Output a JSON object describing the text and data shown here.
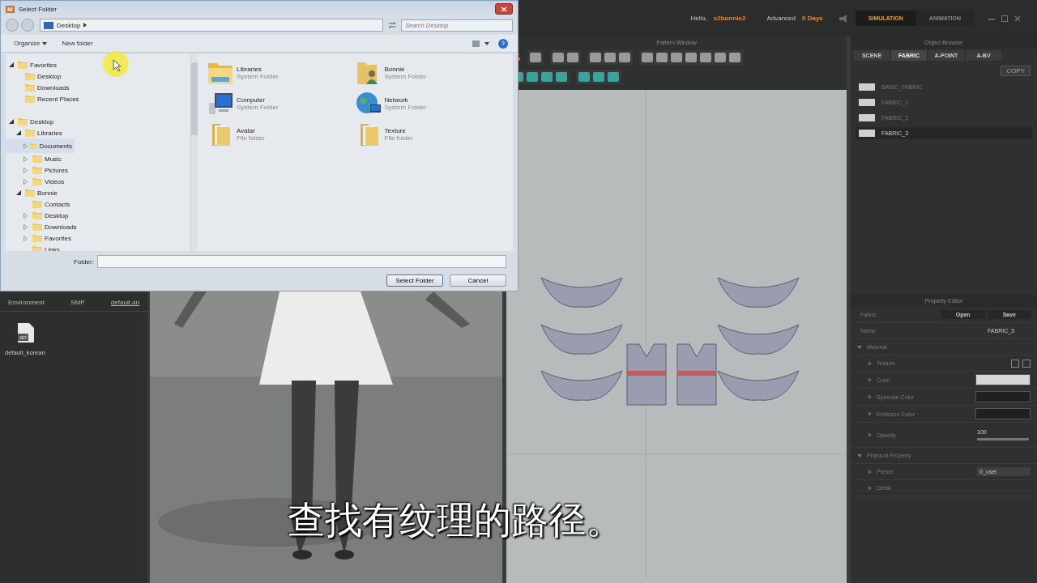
{
  "top_bar": {
    "greeting": "Hello,",
    "user": "s2bonnie2",
    "plan": "Advanced",
    "days": "0 Days",
    "modes": [
      {
        "label": "SIMULATION",
        "selected": true
      },
      {
        "label": "ANIMATION",
        "selected": false
      }
    ]
  },
  "left_panel": {
    "tabs": [
      {
        "label": "Environment",
        "selected": false
      },
      {
        "label": "SMP",
        "selected": false
      },
      {
        "label": "default.an",
        "selected": true
      }
    ],
    "files": [
      {
        "badge": "an",
        "name": "default_korean"
      }
    ]
  },
  "pattern_window": {
    "title": "Pattern Window"
  },
  "object_browser": {
    "title": "Object Browser",
    "tabs": [
      {
        "label": "SCENE",
        "selected": false
      },
      {
        "label": "FABRIC",
        "selected": true
      },
      {
        "label": "A-POINT",
        "selected": false
      },
      {
        "label": "A-BV",
        "selected": false
      }
    ],
    "buttons": [
      "COPY"
    ],
    "fabrics": [
      {
        "name": "BASIC_FABRIC",
        "selected": false
      },
      {
        "name": "FABRIC_1",
        "selected": false
      },
      {
        "name": "FABRIC_2",
        "selected": false
      },
      {
        "name": "FABRIC_3",
        "selected": true
      }
    ]
  },
  "property_editor": {
    "title": "Property Editor",
    "rows": [
      {
        "kind": "buttons",
        "label": "Fabric",
        "buttons": [
          "Open",
          "Save"
        ]
      },
      {
        "kind": "value",
        "label": "Name",
        "value": "FABRIC_3"
      },
      {
        "kind": "section",
        "label": "Material",
        "expanded": true
      },
      {
        "kind": "texture",
        "label": "Texture"
      },
      {
        "kind": "color",
        "label": "Color",
        "color": "#d6d6d6"
      },
      {
        "kind": "color",
        "label": "Specular Color",
        "color": "#1f2020"
      },
      {
        "kind": "color",
        "label": "Emission Color",
        "color": "#1f2020"
      },
      {
        "kind": "slider",
        "label": "Opacity",
        "value": "100",
        "level": 0.97
      },
      {
        "kind": "section",
        "label": "Physical Property",
        "expanded": true
      },
      {
        "kind": "select",
        "label": "Preset",
        "value": "0_user"
      },
      {
        "kind": "item",
        "label": "Detail"
      }
    ]
  },
  "dialog": {
    "title": "Select Folder",
    "app_icon_text": "M",
    "address": "Desktop",
    "search_placeholder": "Search Desktop",
    "toolbar": [
      {
        "label": "Organize",
        "dropdown": true
      },
      {
        "label": "New folder",
        "dropdown": false
      }
    ],
    "tree": [
      {
        "label": "Favorites",
        "kind": "expanded",
        "selected": false,
        "children": [
          {
            "label": "Desktop",
            "kind": "leaf",
            "selected": false
          },
          {
            "label": "Downloads",
            "kind": "leaf",
            "selected": false
          },
          {
            "label": "Recent Places",
            "kind": "leaf",
            "selected": false
          }
        ]
      },
      {
        "label": "Desktop",
        "kind": "expanded",
        "selected": false,
        "children": [
          {
            "label": "Libraries",
            "kind": "expanded",
            "selected": false,
            "children": [
              {
                "label": "Documents",
                "kind": "collapsed",
                "selected": true
              },
              {
                "label": "Music",
                "kind": "collapsed",
                "selected": false
              },
              {
                "label": "Pictures",
                "kind": "collapsed",
                "selected": false
              },
              {
                "label": "Videos",
                "kind": "collapsed",
                "selected": false
              }
            ]
          },
          {
            "label": "Bonnie",
            "kind": "expanded",
            "selected": false,
            "children": [
              {
                "label": "Contacts",
                "kind": "leaf",
                "selected": false
              },
              {
                "label": "Desktop",
                "kind": "collapsed",
                "selected": false
              },
              {
                "label": "Downloads",
                "kind": "collapsed",
                "selected": false
              },
              {
                "label": "Favorites",
                "kind": "collapsed",
                "selected": false
              },
              {
                "label": "Links",
                "kind": "leaf",
                "selected": false
              }
            ]
          }
        ]
      }
    ],
    "items": [
      {
        "name": "Libraries",
        "type": "System Folder"
      },
      {
        "name": "Bonnie",
        "type": "System Folder"
      },
      {
        "name": "Computer",
        "type": "System Folder"
      },
      {
        "name": "Network",
        "type": "System Folder"
      },
      {
        "name": "Avatar",
        "type": "File folder"
      },
      {
        "name": "Texture",
        "type": "File folder"
      }
    ],
    "folder_label": "Folder:",
    "buttons": [
      {
        "label": "Select Folder",
        "default": true
      },
      {
        "label": "Cancel",
        "default": false
      }
    ]
  },
  "subtitle": "查找有纹理的路径。"
}
